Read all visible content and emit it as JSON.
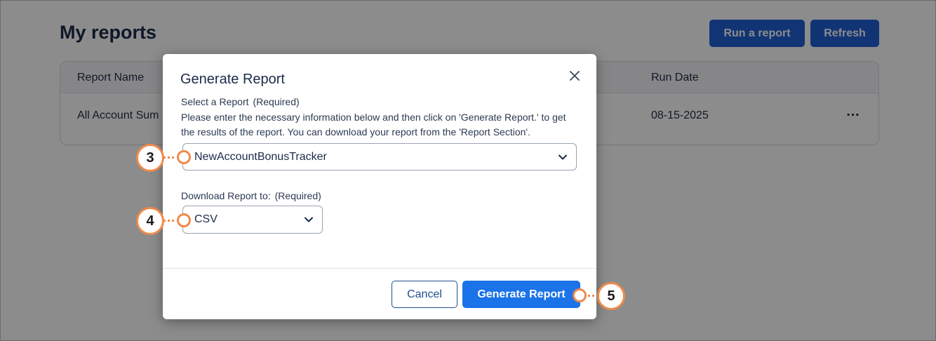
{
  "page": {
    "title": "My reports",
    "run_report_label": "Run a report",
    "refresh_label": "Refresh"
  },
  "table": {
    "columns": {
      "name": "Report Name",
      "run_date": "Run Date"
    },
    "rows": [
      {
        "name": "All Account Sum",
        "run_date": "08-15-2025",
        "menu": "…"
      }
    ]
  },
  "modal": {
    "title": "Generate Report",
    "select_label": "Select a Report",
    "required_tag": "(Required)",
    "help_text": "Please enter the necessary information below and then click on 'Generate Report.' to get the results of the report. You can download your report from the 'Report Section'.",
    "report_value": "NewAccountBonusTracker",
    "download_label": "Download Report to:",
    "download_required_tag": "(Required)",
    "format_value": "CSV",
    "cancel_label": "Cancel",
    "generate_label": "Generate Report"
  },
  "callouts": {
    "step3": "3",
    "step4": "4",
    "step5": "5"
  },
  "colors": {
    "primary": "#1a73e8",
    "header_button": "#1f5fd4",
    "callout": "#f08a4b",
    "title_text": "#1c2b4a"
  },
  "icons": {
    "close": "close-icon",
    "dropdown": "chevron-down-icon",
    "row_menu": "more-horizontal-icon"
  }
}
